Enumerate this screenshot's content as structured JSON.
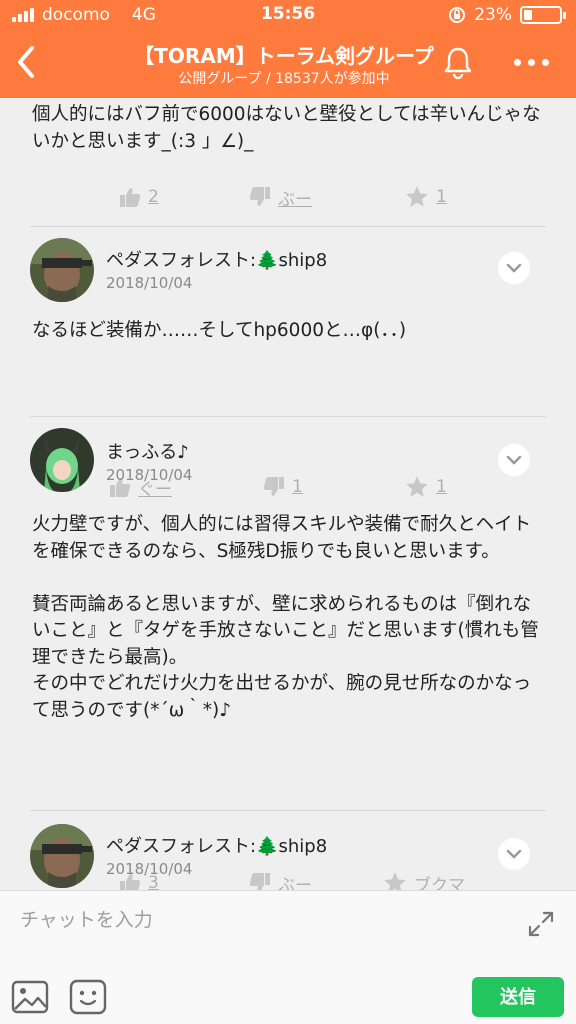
{
  "status_bar": {
    "carrier": "docomo",
    "network": "4G",
    "time": "15:56",
    "battery_percent": "23%",
    "battery_level": 0.23
  },
  "header": {
    "title": "【TORAM】トーラム剣グループ",
    "subtitle": "公開グループ / 18537人が参加中"
  },
  "posts": [
    {
      "body": "個人的にはバフ前で6000はないと壁役としては辛いんじゃないかと思います_(:3 」∠)_",
      "like": "2",
      "dislike": "ぶー",
      "star": "1"
    },
    {
      "name": "ペダスフォレスト:🌲ship8",
      "date": "2018/10/04",
      "body": "なるほど装備か……そしてhp6000と…φ(．．)",
      "like": "ぐー",
      "dislike": "1",
      "star": "1"
    },
    {
      "name": "まっふる♪",
      "date": "2018/10/04",
      "body": "火力壁ですが、個人的には習得スキルや装備で耐久とヘイトを確保できるのなら、S極残D振りでも良いと思います。\n\n賛否両論あると思いますが、壁に求められるものは『倒れないこと』と『タゲを手放さないこと』だと思います(慣れも管理できたら最高)。\nその中でどれだけ火力を出せるかが、腕の見せ所なのかなって思うのです(*´ω｀*)♪",
      "like": "3",
      "dislike": "ぶー",
      "star": "ブクマ"
    },
    {
      "name": "ペダスフォレスト:🌲ship8",
      "date": "2018/10/04"
    }
  ],
  "composer": {
    "placeholder": "チャットを入力",
    "send_label": "送信"
  },
  "colors": {
    "accent": "#ff7a3d",
    "send": "#22c55e"
  },
  "icons": [
    "back-icon",
    "bell-icon",
    "more-icon",
    "thumbs-up-icon",
    "thumbs-down-icon",
    "star-icon",
    "chevron-down-icon",
    "expand-icon",
    "photo-icon",
    "sticker-icon"
  ]
}
